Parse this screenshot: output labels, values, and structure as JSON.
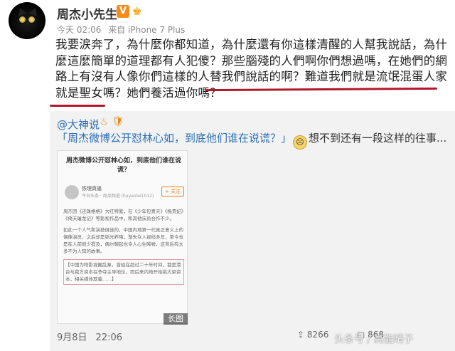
{
  "post": {
    "user_name": "周杰小先生",
    "vip_badge": "V",
    "level_badge": "♚",
    "time": "今天 02:06",
    "source": "来自 iPhone 7 Plus",
    "text_part1": "我要涙奔了，為什麼你都知道，為什麼還有你這樣清醒的人幫我說話，為什麼這麼簡單的道理都有人犯傻？那些腦殘的人們啊你們想過嗎，在她們的網路上有沒有人像你們這樣的人替我們說話的啊？",
    "text_part2": "難道我們就是流氓混蛋人家就是聖女嗎？她們養活過你嗎？"
  },
  "repost": {
    "source_user": "@大神说",
    "source_badges": "♨ 🛡",
    "quote_text": "「周杰微博公开怼林心如，到底他们谁在说谎？」",
    "quote_suffix": "想不到还有一段这样的往事...",
    "emoji": "😐",
    "article": {
      "title": "周杰微博公开怼林心如，到底他们谁在说谎？",
      "author": "铁理真骚",
      "author_sub": "今日头条 · 商品频道 (huyanlei1012)",
      "follow_label": "+ 关注",
      "para1": "周杰因《还珠格格》大红特紫，在《少年包青天》《杨贵妃》《倚天屠龙记》等影视作品中，和其他演员合作不少。",
      "para2": "如此一个人气和演技俱佳的，中国内地第一代真正意义上的偶像演员，之后却是韬光养晦，渐失众人视线多年，至今也是在人前很少提及，偶尔聊起也令人心生唏嘘，这背后有太多不为人知的故事。",
      "para3": "【中国为啥影视圈乱象，曾经在超过二十年时间，都是港台与我方资本在争夺主导地位，而后来内地开始挑大梁资本，相关媒体欺骗……】",
      "long_tag": "长图"
    },
    "date": "9月8日",
    "time": "22:06",
    "share_count": "8266",
    "comment_count": "868"
  },
  "watermark": "头条号 / 高能晴子"
}
